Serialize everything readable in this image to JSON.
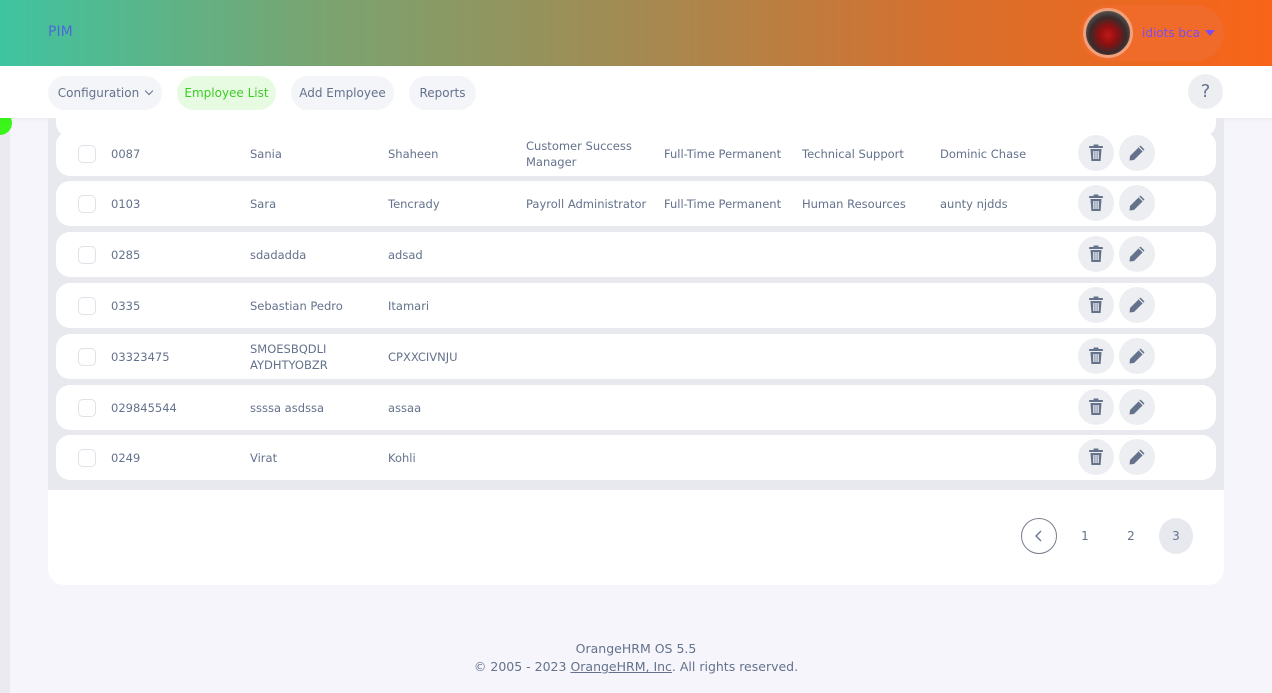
{
  "header": {
    "title": "PIM",
    "user_name": "idiots bca"
  },
  "topnav": {
    "configuration": "Configuration",
    "employee_list": "Employee List",
    "add_employee": "Add Employee",
    "reports": "Reports",
    "help": "?"
  },
  "rows": [
    {
      "id": "0087",
      "first": "Sania",
      "last": "Shaheen",
      "job": "Customer Success Manager",
      "status": "Full-Time Permanent",
      "sub_unit": "Technical Support",
      "supervisor": "Dominic Chase"
    },
    {
      "id": "0103",
      "first": "Sara",
      "last": "Tencrady",
      "job": "Payroll Administrator",
      "status": "Full-Time Permanent",
      "sub_unit": "Human Resources",
      "supervisor": "aunty njdds"
    },
    {
      "id": "0285",
      "first": "sdadadda",
      "last": "adsad",
      "job": "",
      "status": "",
      "sub_unit": "",
      "supervisor": ""
    },
    {
      "id": "0335",
      "first": "Sebastian Pedro",
      "last": "Itamari",
      "job": "",
      "status": "",
      "sub_unit": "",
      "supervisor": ""
    },
    {
      "id": "03323475",
      "first": "SMOESBQDLI AYDHTYOBZR",
      "last": "CPXXCIVNJU",
      "job": "",
      "status": "",
      "sub_unit": "",
      "supervisor": ""
    },
    {
      "id": "029845544",
      "first": "ssssa asdssa",
      "last": "assaa",
      "job": "",
      "status": "",
      "sub_unit": "",
      "supervisor": ""
    },
    {
      "id": "0249",
      "first": "Virat",
      "last": "Kohli",
      "job": "",
      "status": "",
      "sub_unit": "",
      "supervisor": ""
    }
  ],
  "pagination": {
    "pages": [
      "1",
      "2",
      "3"
    ],
    "current": "3"
  },
  "footer": {
    "version": "OrangeHRM OS 5.5",
    "copyright_prefix": "© 2005 - 2023 ",
    "company_link": "OrangeHRM, Inc",
    "copyright_suffix": ". All rights reserved."
  },
  "colors": {
    "accent_green": "#3fcc28",
    "header_start": "#3fc4a0",
    "header_end": "#f86418"
  }
}
